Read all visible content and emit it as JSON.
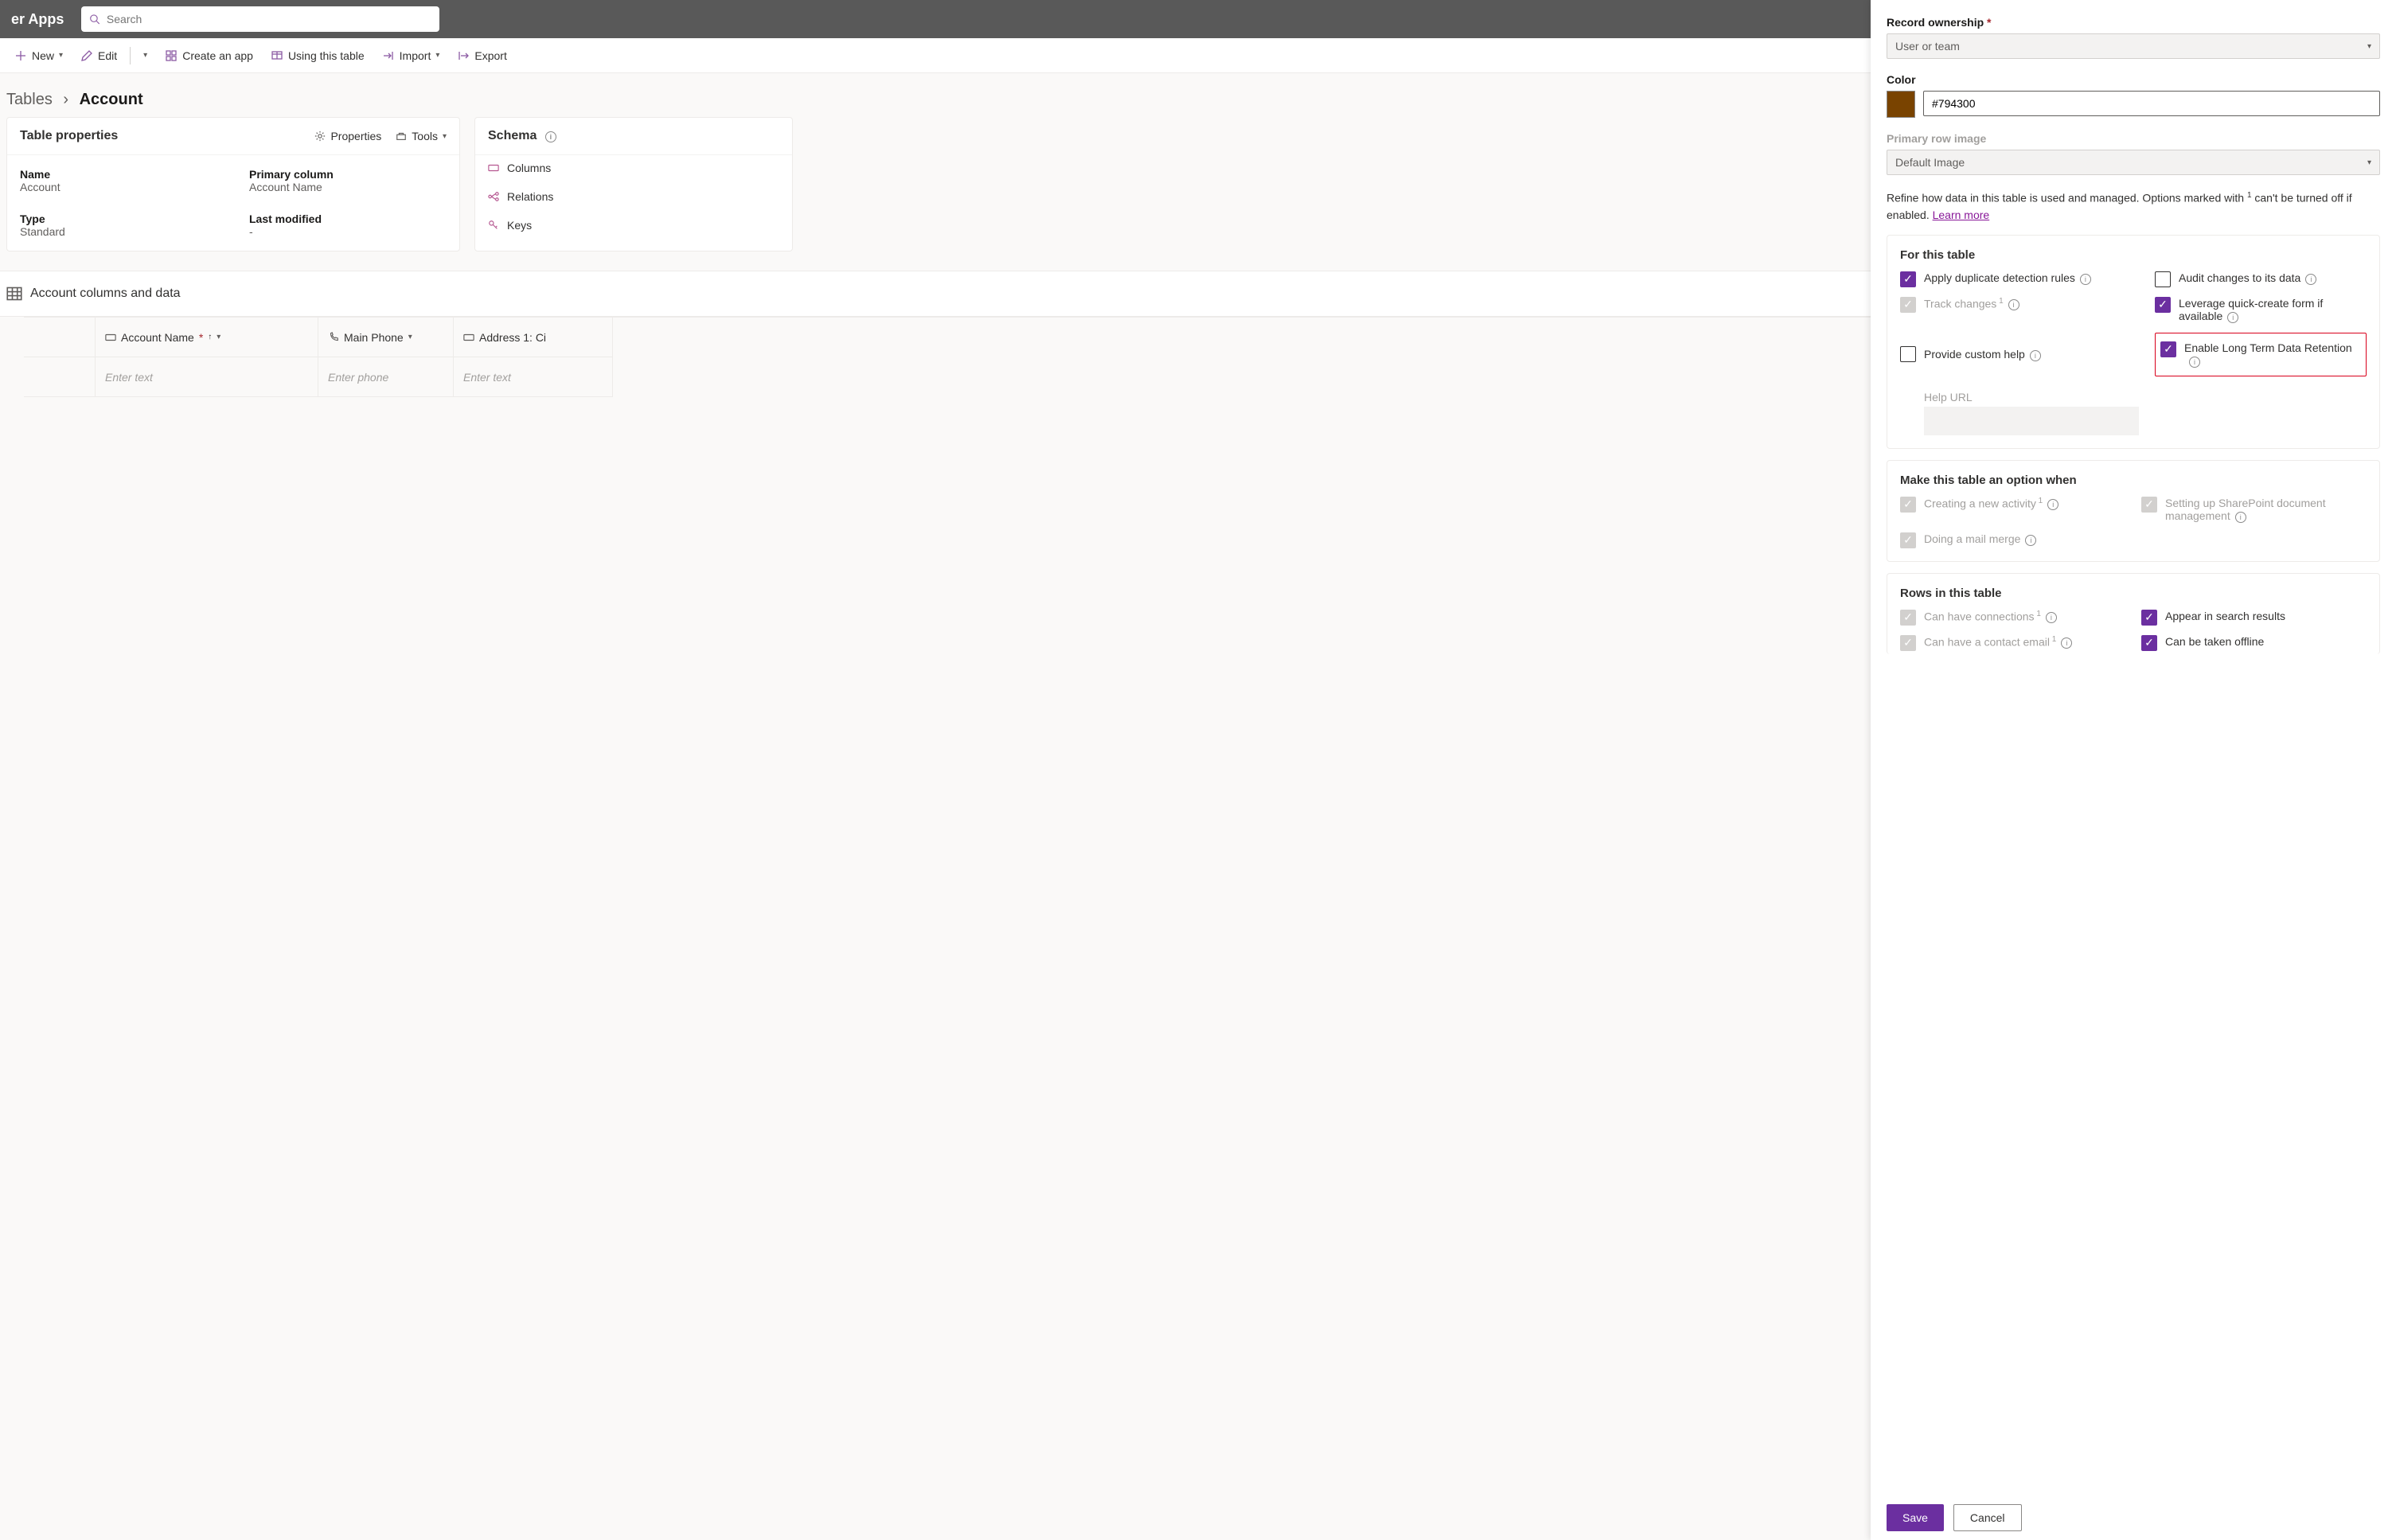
{
  "header": {
    "brand": "er Apps",
    "search_placeholder": "Search"
  },
  "commands": {
    "new": "New",
    "edit": "Edit",
    "create_app": "Create an app",
    "using_table": "Using this table",
    "import": "Import",
    "export": "Export"
  },
  "breadcrumb": {
    "root": "Tables",
    "here": "Account"
  },
  "table_properties": {
    "title": "Table properties",
    "properties_link": "Properties",
    "tools_link": "Tools",
    "rows": {
      "name_label": "Name",
      "name_value": "Account",
      "primary_col_label": "Primary column",
      "primary_col_value": "Account Name",
      "type_label": "Type",
      "type_value": "Standard",
      "last_mod_label": "Last modified",
      "last_mod_value": "-"
    }
  },
  "schema": {
    "title": "Schema",
    "items": [
      "Columns",
      "Relations",
      "Keys"
    ]
  },
  "coldata": {
    "title": "Account columns and data"
  },
  "grid": {
    "cols": [
      {
        "label": "Account Name",
        "required": true,
        "sort_up": true,
        "placeholder": "Enter text",
        "type": "text"
      },
      {
        "label": "Main Phone",
        "placeholder": "Enter phone",
        "type": "phone"
      },
      {
        "label": "Address 1: Ci",
        "placeholder": "Enter text",
        "type": "text"
      }
    ]
  },
  "panel": {
    "record_ownership": {
      "label": "Record ownership",
      "value": "User or team",
      "required": true,
      "disabled": true
    },
    "color": {
      "label": "Color",
      "value": "#794300",
      "swatch": "#794300"
    },
    "primary_row_image": {
      "label": "Primary row image",
      "value": "Default Image",
      "disabled": true
    },
    "refine_text_a": "Refine how data in this table is used and managed. Options marked with ",
    "refine_text_b": " can't be turned off if enabled. ",
    "learn_more": "Learn more",
    "sections": {
      "for_table": {
        "title": "For this table",
        "opts": [
          {
            "label": "Apply duplicate detection rules",
            "checked": true,
            "info": true
          },
          {
            "label": "Audit changes to its data",
            "checked": false,
            "info": true
          },
          {
            "label": "Track changes",
            "sup": true,
            "disabled": true,
            "checked": true,
            "info": true
          },
          {
            "label": "Leverage quick-create form if available",
            "checked": true,
            "info": true
          },
          {
            "label": "Provide custom help",
            "checked": false,
            "info": true
          },
          {
            "label": "Enable Long Term Data Retention",
            "checked": true,
            "info": true,
            "highlight": true
          }
        ],
        "help_url_label": "Help URL"
      },
      "option_when": {
        "title": "Make this table an option when",
        "opts": [
          {
            "label": "Creating a new activity",
            "sup": true,
            "disabled": true,
            "checked": true,
            "info": true
          },
          {
            "label": "Setting up SharePoint document management",
            "disabled": true,
            "checked": true,
            "info": true
          },
          {
            "label": "Doing a mail merge",
            "disabled": true,
            "checked": true,
            "info": true
          }
        ]
      },
      "rows": {
        "title": "Rows in this table",
        "opts": [
          {
            "label": "Can have connections",
            "sup": true,
            "disabled": true,
            "checked": true,
            "info": true
          },
          {
            "label": "Appear in search results",
            "checked": true
          },
          {
            "label": "Can have a contact email",
            "sup": true,
            "disabled": true,
            "checked": true,
            "info": true
          },
          {
            "label": "Can be taken offline",
            "checked": true
          }
        ]
      }
    },
    "footer": {
      "save": "Save",
      "cancel": "Cancel"
    }
  }
}
